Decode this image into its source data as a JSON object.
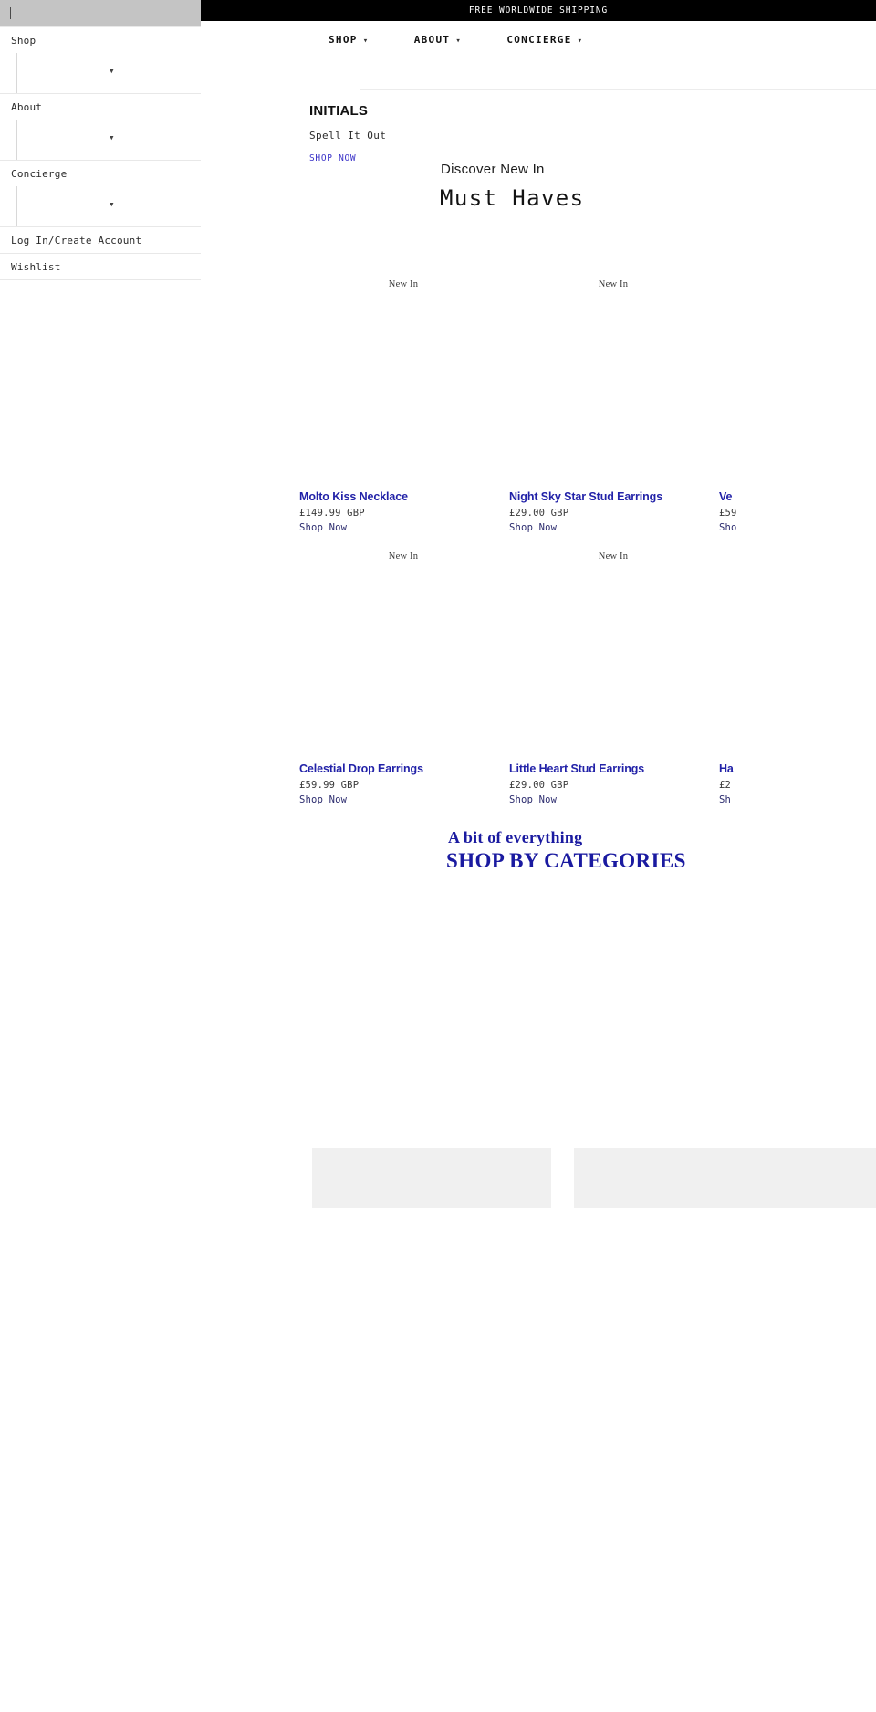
{
  "announcement": {
    "text": "FREE WORLDWIDE SHIPPING"
  },
  "search": {
    "value": "",
    "placeholder": ""
  },
  "topnav": {
    "items": [
      {
        "label": "SHOP",
        "chevron": "▾"
      },
      {
        "label": "ABOUT",
        "chevron": "▾"
      },
      {
        "label": "CONCIERGE",
        "chevron": "▾"
      }
    ]
  },
  "drawer": {
    "groups": [
      {
        "label": "Shop",
        "expander": "▾"
      },
      {
        "label": "About",
        "expander": "▾"
      },
      {
        "label": "Concierge",
        "expander": "▾"
      }
    ],
    "links": [
      {
        "label": "Log In/Create Account"
      },
      {
        "label": "Wishlist"
      }
    ]
  },
  "hero": {
    "title": "INITIALS",
    "subtitle": "Spell It Out",
    "cta": "SHOP NOW"
  },
  "must_haves": {
    "eyebrow": "Discover New In",
    "title": "Must Haves",
    "badge": "New In",
    "shop_label": "Shop Now",
    "products": [
      {
        "name": "Molto Kiss Necklace",
        "price": "£149.99 GBP",
        "badge": "New In",
        "shop": "Shop Now"
      },
      {
        "name": "Night Sky Star Stud Earrings",
        "price": "£29.00 GBP",
        "badge": "New In",
        "shop": "Shop Now"
      },
      {
        "name": "Ve",
        "price": "£59",
        "badge": "",
        "shop": "Sho"
      },
      {
        "name": "Celestial Drop Earrings",
        "price": "£59.99 GBP",
        "badge": "New In",
        "shop": "Shop Now"
      },
      {
        "name": "Little Heart Stud Earrings",
        "price": "£29.00 GBP",
        "badge": "New In",
        "shop": "Shop Now"
      },
      {
        "name": "Ha",
        "price": "£2",
        "badge": "",
        "shop": "Sh"
      }
    ]
  },
  "categories": {
    "eyebrow": "A bit of everything",
    "title": "SHOP BY CATEGORIES",
    "tiles": [
      {
        "label": ""
      },
      {
        "label": ""
      }
    ]
  },
  "colors": {
    "accent_blue": "#2222a8",
    "link_blue": "#3a32c8",
    "heading_blue": "#1a1aa0",
    "announce_bg": "#000000",
    "search_bg": "#c4c4c4",
    "tile_bg": "#f0f0f0"
  }
}
